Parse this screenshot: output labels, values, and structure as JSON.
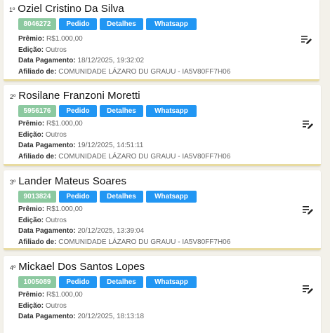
{
  "cards": [
    {
      "position": "1º",
      "name": "Oziel Cristino Da Silva",
      "code": "8046272",
      "buttons": {
        "pedido": "Pedido",
        "detalhes": "Detalhes",
        "whatsapp": "Whatsapp"
      },
      "premio_label": "Prêmio:",
      "premio": "R$1.000,00",
      "edicao_label": "Edição:",
      "edicao": "Outros",
      "data_label": "Data Pagamento:",
      "data": "18/12/2025, 19:32:02",
      "afiliado_label": "Afiliado de:",
      "afiliado": "COMUNIDADE LÁZARO DU GRAUU - IA5V80FF7H06"
    },
    {
      "position": "2º",
      "name": "Rosilane Franzoni Moretti",
      "code": "5956176",
      "buttons": {
        "pedido": "Pedido",
        "detalhes": "Detalhes",
        "whatsapp": "Whatsapp"
      },
      "premio_label": "Prêmio:",
      "premio": "R$1.000,00",
      "edicao_label": "Edição:",
      "edicao": "Outros",
      "data_label": "Data Pagamento:",
      "data": "19/12/2025, 14:51:11",
      "afiliado_label": "Afiliado de:",
      "afiliado": "COMUNIDADE LÁZARO DU GRAUU - IA5V80FF7H06"
    },
    {
      "position": "3º",
      "name": "Lander Mateus Soares",
      "code": "9013824",
      "buttons": {
        "pedido": "Pedido",
        "detalhes": "Detalhes",
        "whatsapp": "Whatsapp"
      },
      "premio_label": "Prêmio:",
      "premio": "R$1.000,00",
      "edicao_label": "Edição:",
      "edicao": "Outros",
      "data_label": "Data Pagamento:",
      "data": "20/12/2025, 13:39:04",
      "afiliado_label": "Afiliado de:",
      "afiliado": "COMUNIDADE LÁZARO DU GRAUU - IA5V80FF7H06"
    },
    {
      "position": "4º",
      "name": "Mickael Dos Santos Lopes",
      "code": "1005089",
      "buttons": {
        "pedido": "Pedido",
        "detalhes": "Detalhes",
        "whatsapp": "Whatsapp"
      },
      "premio_label": "Prêmio:",
      "premio": "R$1.000,00",
      "edicao_label": "Edição:",
      "edicao": "Outros",
      "data_label": "Data Pagamento:",
      "data": "20/12/2025, 18:13:18"
    }
  ],
  "icons": {
    "edit": "edit-list-icon"
  },
  "colors": {
    "code_badge": "#8cc9a0",
    "button": "#2196f3",
    "card_border": "#e8dba0"
  }
}
